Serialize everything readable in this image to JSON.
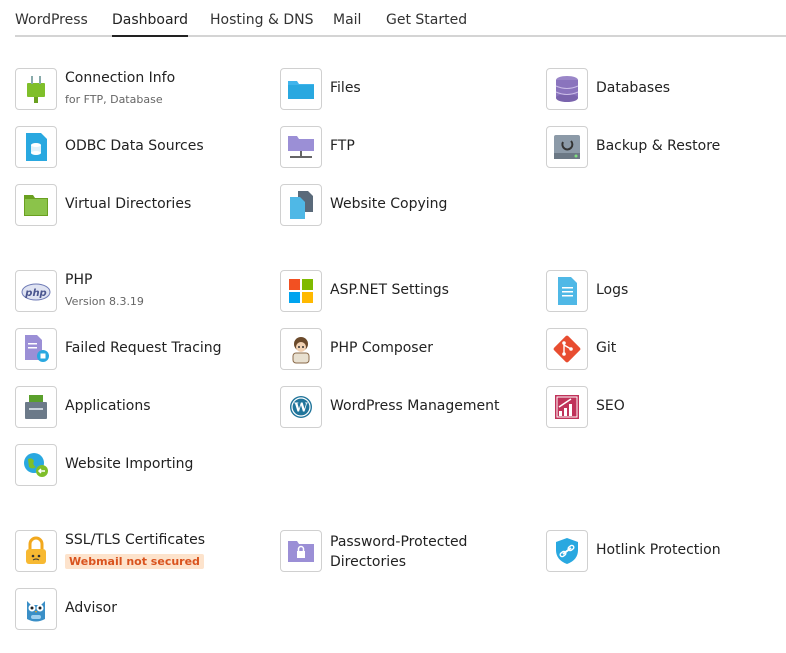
{
  "tabs": {
    "wordpress": "WordPress",
    "dashboard": "Dashboard",
    "hosting": "Hosting & DNS",
    "mail": "Mail",
    "get_started": "Get Started"
  },
  "tiles": {
    "connection_info": {
      "label": "Connection Info",
      "sub": "for FTP, Database",
      "icon": "plug-icon"
    },
    "files": {
      "label": "Files",
      "icon": "folder-icon"
    },
    "databases": {
      "label": "Databases",
      "icon": "database-icon"
    },
    "odbc": {
      "label": "ODBC Data Sources",
      "icon": "odbc-icon"
    },
    "ftp": {
      "label": "FTP",
      "icon": "ftp-folder-icon"
    },
    "backup": {
      "label": "Backup & Restore",
      "icon": "backup-icon"
    },
    "virtual_dirs": {
      "label": "Virtual Directories",
      "icon": "green-folder-icon"
    },
    "website_copying": {
      "label": "Website Copying",
      "icon": "copy-icon"
    },
    "php": {
      "label": "PHP",
      "sub": "Version 8.3.19",
      "icon": "php-icon"
    },
    "aspnet": {
      "label": "ASP.NET Settings",
      "icon": "windows-icon"
    },
    "logs": {
      "label": "Logs",
      "icon": "log-file-icon"
    },
    "failed_request": {
      "label": "Failed Request Tracing",
      "icon": "failed-trace-icon"
    },
    "php_composer": {
      "label": "PHP Composer",
      "icon": "composer-icon"
    },
    "git": {
      "label": "Git",
      "icon": "git-icon"
    },
    "applications": {
      "label": "Applications",
      "icon": "applications-icon"
    },
    "wp_management": {
      "label": "WordPress Management",
      "icon": "wordpress-icon"
    },
    "seo": {
      "label": "SEO",
      "icon": "seo-chart-icon"
    },
    "website_importing": {
      "label": "Website Importing",
      "icon": "globe-import-icon"
    },
    "ssl": {
      "label": "SSL/TLS Certificates",
      "badge": "Webmail not secured",
      "icon": "lock-icon"
    },
    "password_dirs": {
      "label": "Password-Protected Directories",
      "icon": "locked-folder-icon"
    },
    "hotlink": {
      "label": "Hotlink Protection",
      "icon": "shield-link-icon"
    },
    "advisor": {
      "label": "Advisor",
      "icon": "owl-icon"
    }
  },
  "colors": {
    "badge_text": "#d9531e",
    "badge_bg": "#fde3cc",
    "accent_blue": "#29a8e0"
  }
}
